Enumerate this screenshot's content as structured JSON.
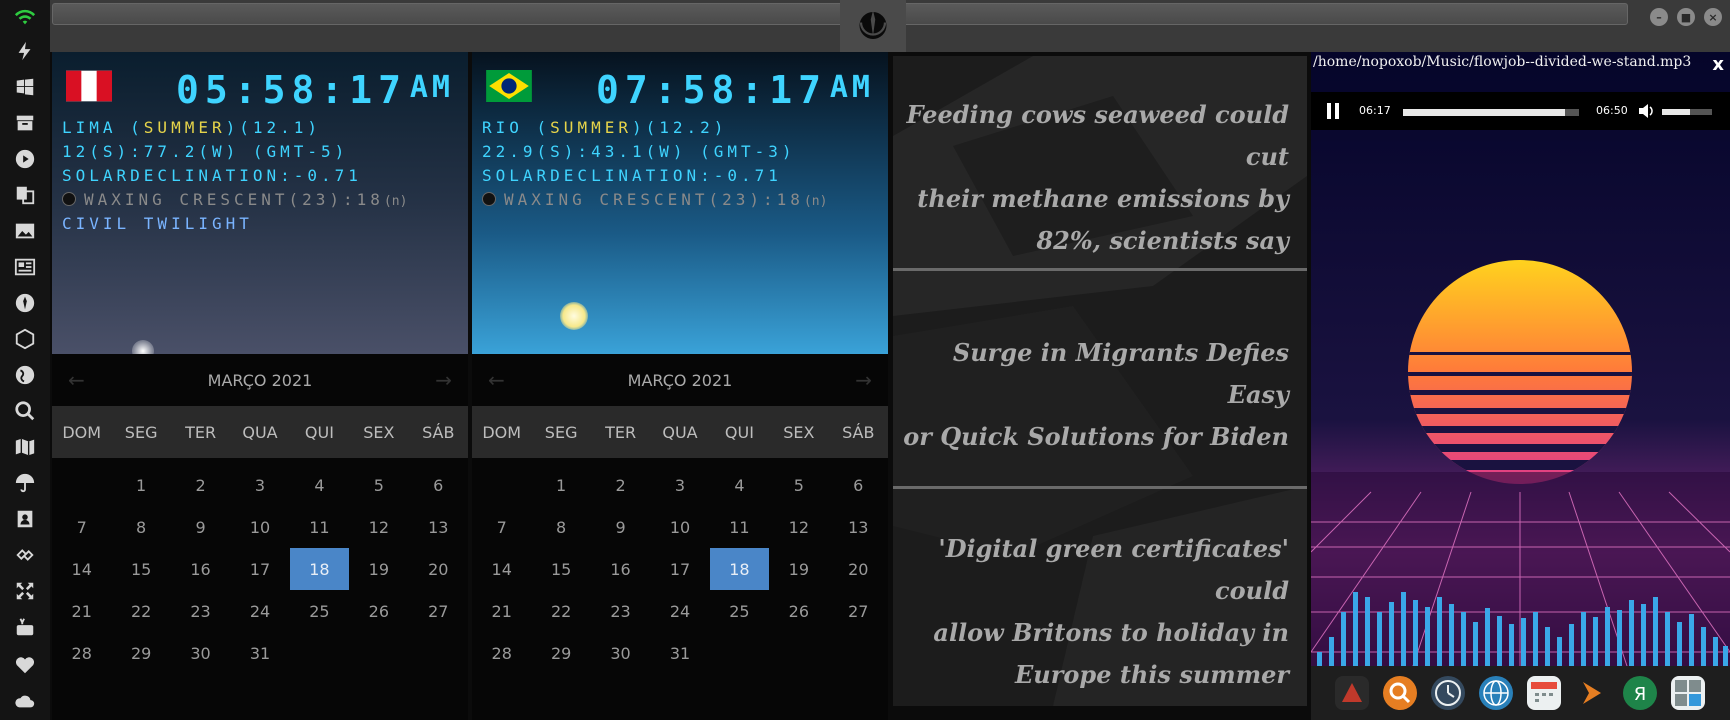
{
  "sidebar": {
    "icons": [
      "wifi-icon",
      "lightning-icon",
      "windows-icon",
      "archive-icon",
      "play-icon",
      "translate-icon",
      "image-icon",
      "news-icon",
      "rebel-icon",
      "hexagon-icon",
      "globe-icon",
      "search-icon",
      "map-icon",
      "umbrella-icon",
      "contacts-icon",
      "link-icon",
      "fullscreen-icon",
      "youtube-icon",
      "heart-icon",
      "cloud-icon"
    ],
    "colors": {
      "wifi": "#2ecc40",
      "default": "#d8d8d8"
    }
  },
  "clocks": [
    {
      "flag": "peru",
      "time": "05:58:17",
      "ampm": "AM",
      "city_prefix": "LIMA (",
      "season": "SUMMER",
      "city_suffix": ")(12.1)",
      "coords": "12(S):77.2(W) (GMT-5)",
      "solar": "SOLARDECLINATION:-0.71",
      "moon": "WAXING CRESCENT(23):18",
      "moon_note": "(n)",
      "twilight": "CIVIL TWILIGHT"
    },
    {
      "flag": "brazil",
      "time": "07:58:17",
      "ampm": "AM",
      "city_prefix": "RIO (",
      "season": "SUMMER",
      "city_suffix": ")(12.2)",
      "coords": "22.9(S):43.1(W) (GMT-3)",
      "solar": "SOLARDECLINATION:-0.71",
      "moon": "WAXING CRESCENT(23):18",
      "moon_note": "(n)",
      "twilight": ""
    }
  ],
  "calendar": {
    "month": "MARÇO 2021",
    "prev": "←",
    "next": "→",
    "dow": [
      "DOM",
      "SEG",
      "TER",
      "QUA",
      "QUI",
      "SEX",
      "SÁB"
    ],
    "days": [
      "",
      "1",
      "2",
      "3",
      "4",
      "5",
      "6",
      "7",
      "8",
      "9",
      "10",
      "11",
      "12",
      "13",
      "14",
      "15",
      "16",
      "17",
      "18",
      "19",
      "20",
      "21",
      "22",
      "23",
      "24",
      "25",
      "26",
      "27",
      "28",
      "29",
      "30",
      "31"
    ],
    "selected": "18"
  },
  "news": [
    {
      "lines": [
        "Feeding cows seaweed could cut",
        "their methane emissions by",
        "82%, scientists say"
      ]
    },
    {
      "lines": [
        "Surge in Migrants Defies Easy",
        "or Quick Solutions for Biden"
      ]
    },
    {
      "lines": [
        "'Digital green certificates' could",
        "allow Britons to holiday in",
        "Europe this summer"
      ]
    }
  ],
  "player": {
    "path": "/home/nopoxob/Music/flowjob--divided-we-stand.mp3",
    "close": "x",
    "elapsed": "06:17",
    "duration": "06:50",
    "progress": 0.92,
    "volume": 0.55
  },
  "dock": {
    "icons": [
      {
        "name": "app-launcher-icon",
        "color": "#c0392b"
      },
      {
        "name": "magnifier-icon",
        "color": "#e67e22"
      },
      {
        "name": "clock-icon",
        "color": "#2c3e50"
      },
      {
        "name": "browser-globe-icon",
        "color": "#2980b9"
      },
      {
        "name": "calendar-icon",
        "color": "#ecf0f1"
      },
      {
        "name": "terminal-arrow-icon",
        "color": "#e67e22"
      },
      {
        "name": "yandex-icon",
        "color": "#27ae60"
      },
      {
        "name": "calculator-icon",
        "color": "#7f8c8d"
      }
    ]
  }
}
